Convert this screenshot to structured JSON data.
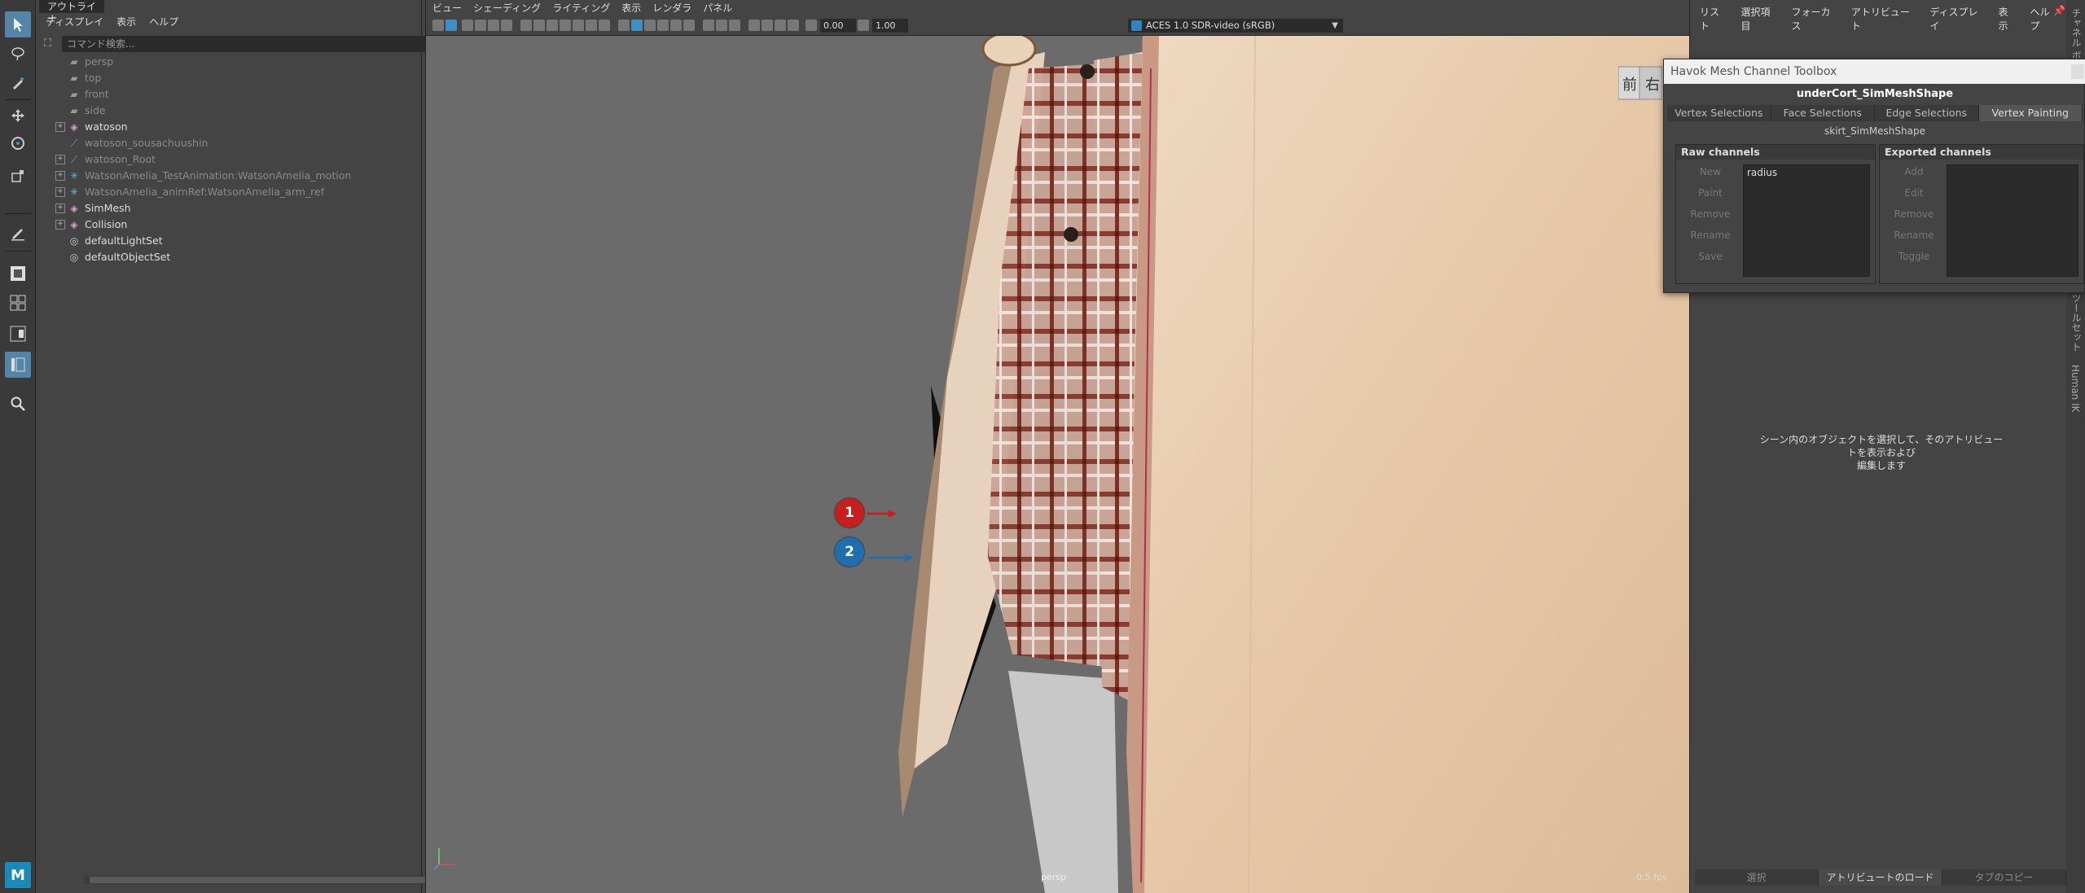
{
  "outliner": {
    "title": "アウトライナ",
    "menu": [
      "ディスプレイ",
      "表示",
      "ヘルプ"
    ],
    "search_placeholder": "コマンド検索...",
    "items": [
      {
        "label": "persp",
        "icon": "camera-icon",
        "expandable": false,
        "dim": true
      },
      {
        "label": "top",
        "icon": "camera-icon",
        "expandable": false,
        "dim": true
      },
      {
        "label": "front",
        "icon": "camera-icon",
        "expandable": false,
        "dim": true
      },
      {
        "label": "side",
        "icon": "camera-icon",
        "expandable": false,
        "dim": true
      },
      {
        "label": "watoson",
        "icon": "group-icon",
        "expandable": true,
        "dim": false
      },
      {
        "label": "watoson_sousachuushin",
        "icon": "joint-icon",
        "expandable": false,
        "dim": true
      },
      {
        "label": "watoson_Root",
        "icon": "joint-icon",
        "expandable": true,
        "dim": true
      },
      {
        "label": "WatsonAmelia_TestAnimation:WatsonAmelia_motion",
        "icon": "reference-icon",
        "expandable": true,
        "dim": true
      },
      {
        "label": "WatsonAmelia_animRef:WatsonAmelia_arm_ref",
        "icon": "reference-icon",
        "expandable": true,
        "dim": true
      },
      {
        "label": "SimMesh",
        "icon": "group-icon",
        "expandable": true,
        "dim": false
      },
      {
        "label": "Collision",
        "icon": "group-icon",
        "expandable": true,
        "dim": false
      },
      {
        "label": "defaultLightSet",
        "icon": "set-icon",
        "expandable": false,
        "dim": false
      },
      {
        "label": "defaultObjectSet",
        "icon": "set-icon",
        "expandable": false,
        "dim": false
      }
    ]
  },
  "viewport": {
    "menu": [
      "ビュー",
      "シェーディング",
      "ライティング",
      "表示",
      "レンダラ",
      "パネル"
    ],
    "exposure": "0.00",
    "gamma": "1.00",
    "color_management": "ACES 1.0 SDR-video (sRGB)",
    "camera": "persp",
    "fps": "0.5 fps",
    "view_cube": {
      "front": "前",
      "right": "右"
    },
    "markers": [
      {
        "label": "1",
        "color": "#c81e1e"
      },
      {
        "label": "2",
        "color": "#1f6fb0"
      }
    ]
  },
  "attribute_editor": {
    "menu": [
      "リスト",
      "選択項目",
      "フォーカス",
      "アトリビュート",
      "ディスプレイ",
      "表示",
      "ヘルプ"
    ],
    "message_line1": "シーン内のオブジェクトを選択して、そのアトリビュートを表示および",
    "message_line2": "編集します",
    "bottom_buttons": [
      {
        "label": "選択",
        "active": false
      },
      {
        "label": "アトリビュートのロード",
        "active": true
      },
      {
        "label": "タブのコピー",
        "active": false
      }
    ],
    "side_tabs": [
      "チャネル ボックス",
      "ツールセット",
      "Human IK"
    ]
  },
  "havok": {
    "title": "Havok Mesh Channel Toolbox",
    "mesh_name": "underCort_SimMeshShape",
    "tabs": [
      {
        "label": "Vertex Selections",
        "active": false
      },
      {
        "label": "Face Selections",
        "active": false
      },
      {
        "label": "Edge Selections",
        "active": false
      },
      {
        "label": "Vertex Painting",
        "active": true
      }
    ],
    "shape_name": "skirt_SimMeshShape",
    "raw_channels": {
      "title": "Raw channels",
      "buttons": [
        "New",
        "Paint",
        "Remove",
        "Rename",
        "Save"
      ],
      "list": [
        "radius"
      ]
    },
    "exported_channels": {
      "title": "Exported channels",
      "buttons": [
        "Add",
        "Edit",
        "Remove",
        "Rename",
        "Toggle"
      ],
      "list": []
    }
  },
  "colors": {
    "selection_blue": "#5285a6",
    "marker_red": "#c81e1e",
    "marker_blue": "#1f6fb0"
  }
}
